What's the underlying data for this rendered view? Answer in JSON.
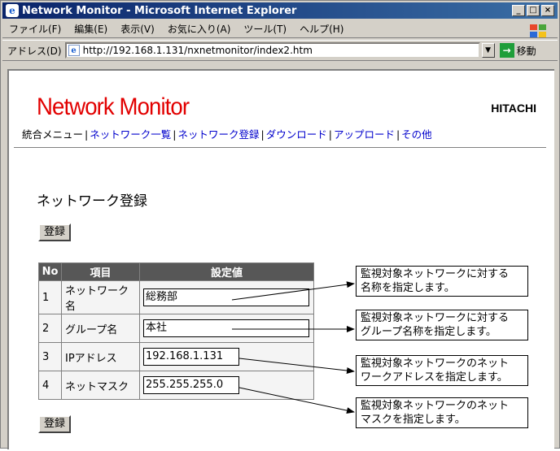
{
  "window": {
    "title": "Network Monitor - Microsoft Internet Explorer",
    "controls": [
      "_",
      "□",
      "×"
    ]
  },
  "menu": [
    "ファイル(F)",
    "編集(E)",
    "表示(V)",
    "お気に入り(A)",
    "ツール(T)",
    "ヘルプ(H)"
  ],
  "address": {
    "label": "アドレス(D)",
    "url": "http://192.168.1.131/nxnetmonitor/index2.htm",
    "go_label": "移動"
  },
  "page": {
    "logo_text": "Network Monitor",
    "brand": "HITACHI",
    "nav": [
      "統合メニュー",
      "ネットワーク一覧",
      "ネットワーク登録",
      "ダウンロード",
      "アップロード",
      "その他"
    ],
    "heading": "ネットワーク登録",
    "register_label": "登録",
    "table": {
      "headers": [
        "No",
        "項目",
        "設定値"
      ],
      "rows": [
        {
          "no": "1",
          "item": "ネットワーク名",
          "value": "総務部"
        },
        {
          "no": "2",
          "item": "グループ名",
          "value": "本社"
        },
        {
          "no": "3",
          "item": "IPアドレス",
          "value": "192.168.1.131"
        },
        {
          "no": "4",
          "item": "ネットマスク",
          "value": "255.255.255.0"
        }
      ]
    },
    "callouts": [
      {
        "line1": "監視対象ネットワークに対する",
        "line2": "名称を指定します。"
      },
      {
        "line1": "監視対象ネットワークに対する",
        "line2": "グループ名称を指定します。"
      },
      {
        "line1": "監視対象ネットワークのネット",
        "line2": "ワークアドレスを指定します。"
      },
      {
        "line1": "監視対象ネットワークのネット",
        "line2": "マスクを指定します。"
      }
    ]
  },
  "colors": {
    "logo_red": "#e20000",
    "titlebar": "#0a246a",
    "link": "#0000cc",
    "table_header": "#575757"
  }
}
